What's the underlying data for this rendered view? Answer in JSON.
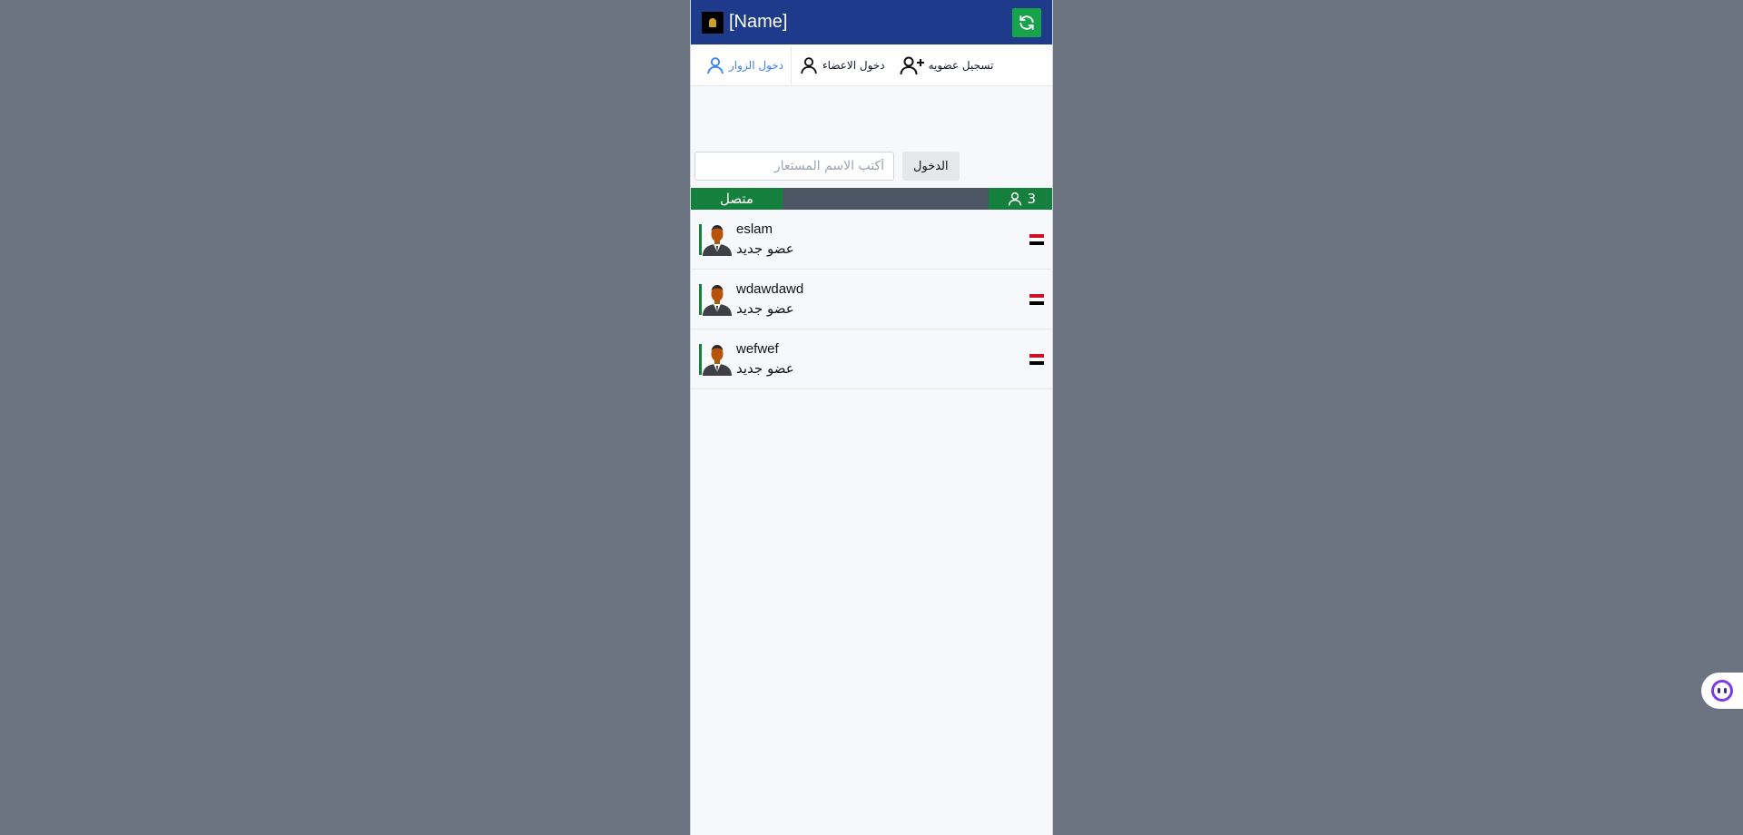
{
  "header": {
    "title": "[Name]",
    "refresh_icon": "refresh-icon"
  },
  "tabs": [
    {
      "label": "دخول الزوار",
      "icon": "user-icon",
      "active": true
    },
    {
      "label": "دخول الاعضاء",
      "icon": "user-icon",
      "active": false
    },
    {
      "label": "تسجيل عضويه",
      "icon": "user-plus-icon",
      "active": false
    }
  ],
  "login": {
    "placeholder": "أكتب الاسم المستعار",
    "value": "",
    "button": "الدخول"
  },
  "status": {
    "online_label": "متصل",
    "count": "3"
  },
  "users": [
    {
      "name": "eslam",
      "status": "عضو جديد",
      "flag": "egypt-flag"
    },
    {
      "name": "wdawdawd",
      "status": "عضو جديد",
      "flag": "egypt-flag"
    },
    {
      "name": "wefwef",
      "status": "عضو جديد",
      "flag": "egypt-flag"
    }
  ],
  "colors": {
    "header": "#1e3a8a",
    "accent_green": "#15803d",
    "active_tab": "#3b82f6",
    "backdrop": "#6b7280"
  }
}
